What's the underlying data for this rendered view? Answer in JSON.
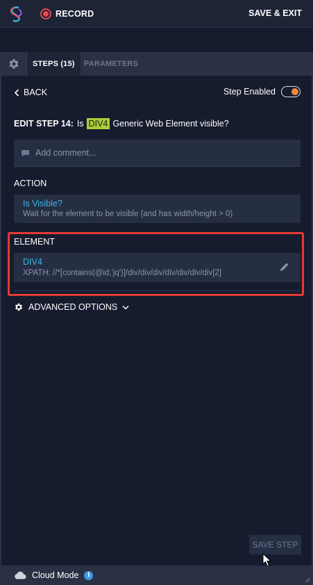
{
  "topbar": {
    "record_label": "RECORD",
    "save_exit_label": "SAVE & EXIT",
    "colors": {
      "record": "#e5484d",
      "background": "#1d2436"
    }
  },
  "tabs": {
    "settings_icon": "gear-icon",
    "steps_label": "STEPS (15)",
    "parameters_label": "PARAMETERS"
  },
  "nav": {
    "back_label": "BACK",
    "step_enabled_label": "Step Enabled",
    "step_enabled_on": true,
    "toggle_color": "#f0883e"
  },
  "edit": {
    "title_prefix": "EDIT STEP 14:",
    "title_is": "Is",
    "element_badge": "DIV4",
    "title_rest": "Generic Web Element visible?",
    "badge_color": "#a9cf38"
  },
  "comment": {
    "placeholder": "Add comment...",
    "value": ""
  },
  "action": {
    "section_label": "ACTION",
    "name": "Is Visible?",
    "description": "Wait for the element to be visible (and has width/height > 0)"
  },
  "element": {
    "section_label": "ELEMENT",
    "name": "DIV4",
    "xpath": "XPATH: //*[contains(@id,'jq')]/div/div/div/div/div/div/div[2]",
    "highlight_color": "#e53935"
  },
  "advanced": {
    "label": "ADVANCED OPTIONS"
  },
  "save_step": {
    "label": "SAVE STEP"
  },
  "footer": {
    "mode_label": "Cloud Mode",
    "info_glyph": "i"
  }
}
